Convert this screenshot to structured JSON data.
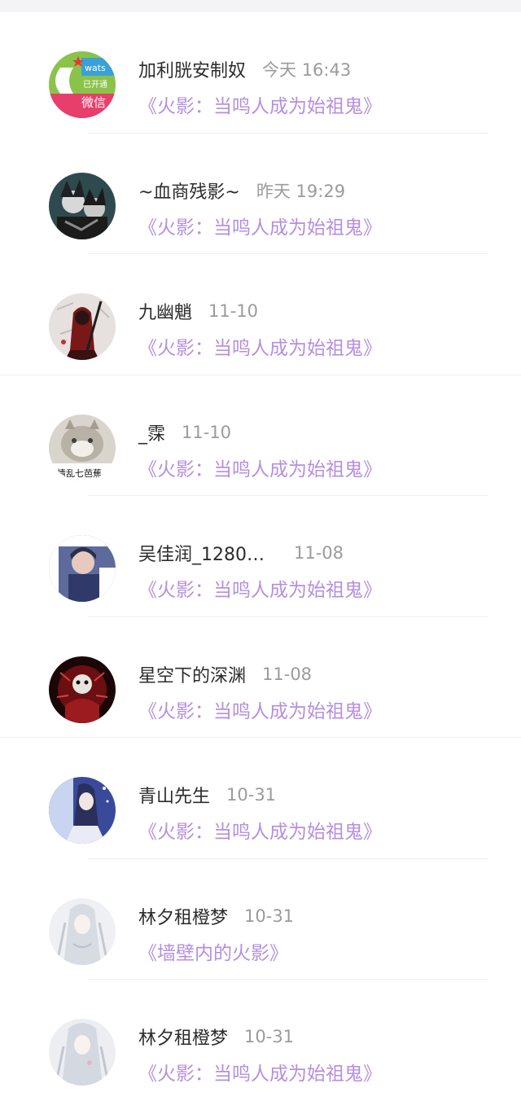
{
  "messages": [
    {
      "name": "加利胱安制奴",
      "time": "今天 16:43",
      "book": "《火影：当鸣人成为始祖鬼》"
    },
    {
      "name": "~血商残影~",
      "time": "昨天 19:29",
      "book": "《火影：当鸣人成为始祖鬼》"
    },
    {
      "name": "九幽魈",
      "time": "11-10",
      "book": "《火影：当鸣人成为始祖鬼》"
    },
    {
      "name": "_霂",
      "time": "11-10",
      "book": "《火影：当鸣人成为始祖鬼》"
    },
    {
      "name": "吴佳润_1280…",
      "time": "11-08",
      "book": "《火影：当鸣人成为始祖鬼》"
    },
    {
      "name": "星空下的深渊",
      "time": "11-08",
      "book": "《火影：当鸣人成为始祖鬼》"
    },
    {
      "name": "青山先生",
      "time": "10-31",
      "book": "《火影：当鸣人成为始祖鬼》"
    },
    {
      "name": "林夕租橙梦",
      "time": "10-31",
      "book": "《墙壁内的火影》"
    },
    {
      "name": "林夕租橙梦",
      "time": "10-31",
      "book": "《火影：当鸣人成为始祖鬼》"
    }
  ],
  "avatar_texts": {
    "a1_brand": "wats",
    "a1_badge": "已开通",
    "a1_main": "微信",
    "a4_caption": "情乱七芭蕉"
  },
  "colors": {
    "accent_link": "#b58fe0",
    "name_text": "#2c2c2c",
    "time_text": "#9b9b9b"
  }
}
